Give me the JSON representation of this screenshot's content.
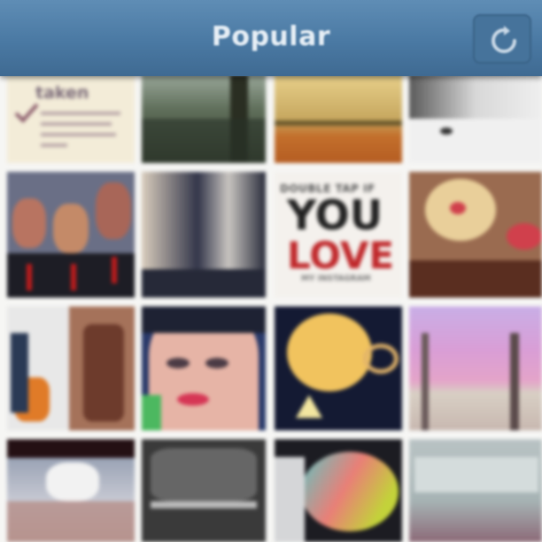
{
  "header": {
    "title": "Popular",
    "refresh_icon": "refresh-icon",
    "color": "#4a79a3"
  },
  "photos": {
    "r1c1": {
      "caption": "taken",
      "icon": "checkmark-icon"
    },
    "r2c3": {
      "line1": "DOUBLE TAP IF",
      "line2": "YOU",
      "line3": "LOVE",
      "line4": "MY INSTAGRAM",
      "accent": "#c0282b"
    }
  }
}
